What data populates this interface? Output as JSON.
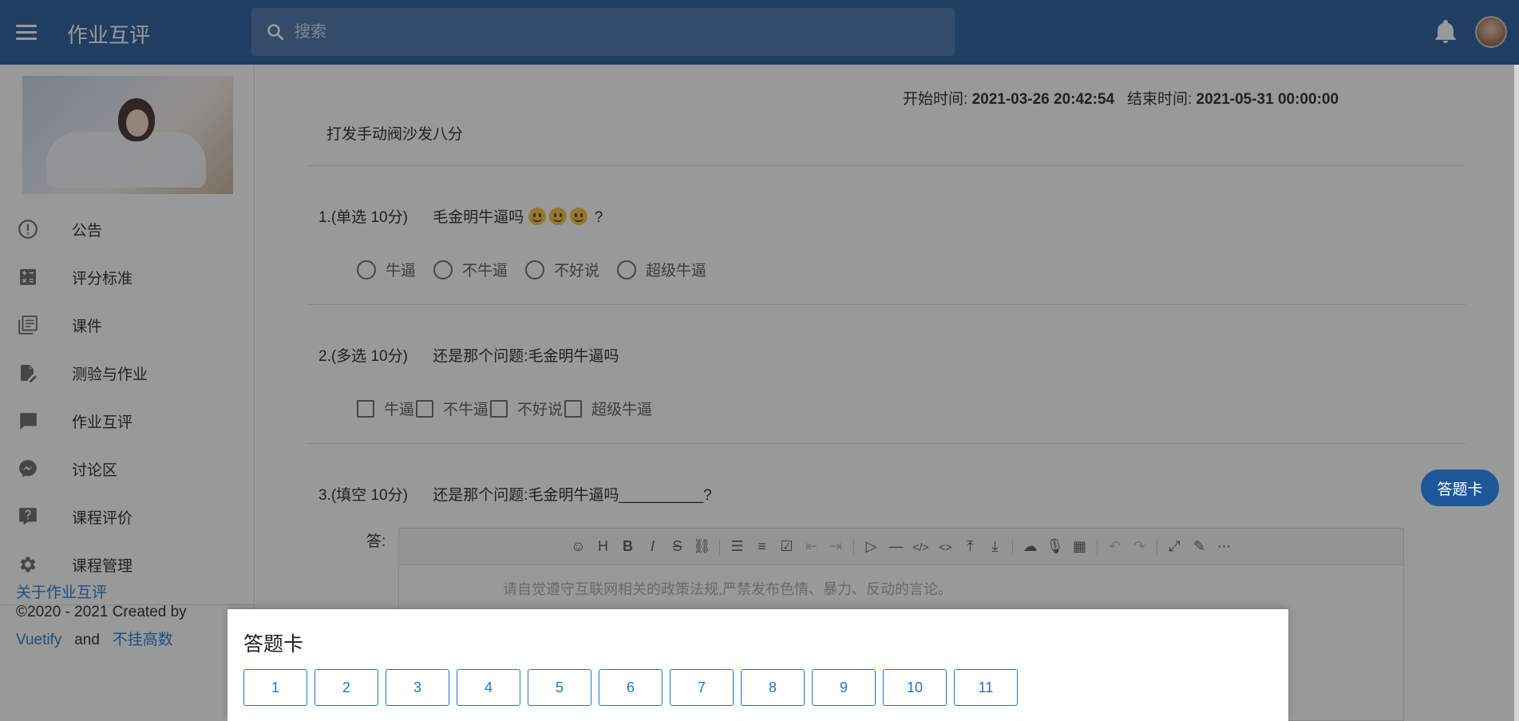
{
  "app": {
    "title": "作业互评",
    "search_placeholder": "搜索"
  },
  "sidebar": {
    "items": [
      {
        "label": "公告",
        "icon": "alert-circle-icon"
      },
      {
        "label": "评分标准",
        "icon": "calculator-icon"
      },
      {
        "label": "课件",
        "icon": "library-books-icon"
      },
      {
        "label": "测验与作业",
        "icon": "file-edit-icon"
      },
      {
        "label": "作业互评",
        "icon": "comment-icon"
      },
      {
        "label": "讨论区",
        "icon": "messenger-icon"
      },
      {
        "label": "课程评价",
        "icon": "comment-question-icon"
      },
      {
        "label": "课程管理",
        "icon": "gear-icon"
      }
    ],
    "footer": {
      "about": "关于作业互评",
      "copyright": "©2020 - 2021 Created by",
      "link1": "Vuetify",
      "and": "and",
      "link2": "不挂高数"
    }
  },
  "main": {
    "start_label": "开始时间:",
    "start_value": "2021-03-26 20:42:54",
    "end_label": "结束时间:",
    "end_value": "2021-05-31 00:00:00",
    "description": "打发手动阀沙发八分",
    "questions": [
      {
        "head": "1.(单选 10分)",
        "text": "毛金明牛逼吗",
        "suffix": "?",
        "options": [
          "牛逼",
          "不牛逼",
          "不好说",
          "超级牛逼"
        ]
      },
      {
        "head": "2.(多选 10分)",
        "text": "还是那个问题:毛金明牛逼吗",
        "options": [
          "牛逼",
          "不牛逼",
          "不好说",
          "超级牛逼"
        ]
      },
      {
        "head": "3.(填空 10分)",
        "text": "还是那个问题:毛金明牛逼吗__________?"
      }
    ],
    "answer_label": "答:",
    "editor_placeholder": "请自觉遵守互联网相关的政策法规,严禁发布色情、暴力、反动的言论。",
    "answer_card_button": "答题卡"
  },
  "answer_card": {
    "title": "答题卡",
    "numbers": [
      "1",
      "2",
      "3",
      "4",
      "5",
      "6",
      "7",
      "8",
      "9",
      "10",
      "11"
    ]
  },
  "colors": {
    "primary": "#1e5799",
    "link": "#1976d2"
  }
}
